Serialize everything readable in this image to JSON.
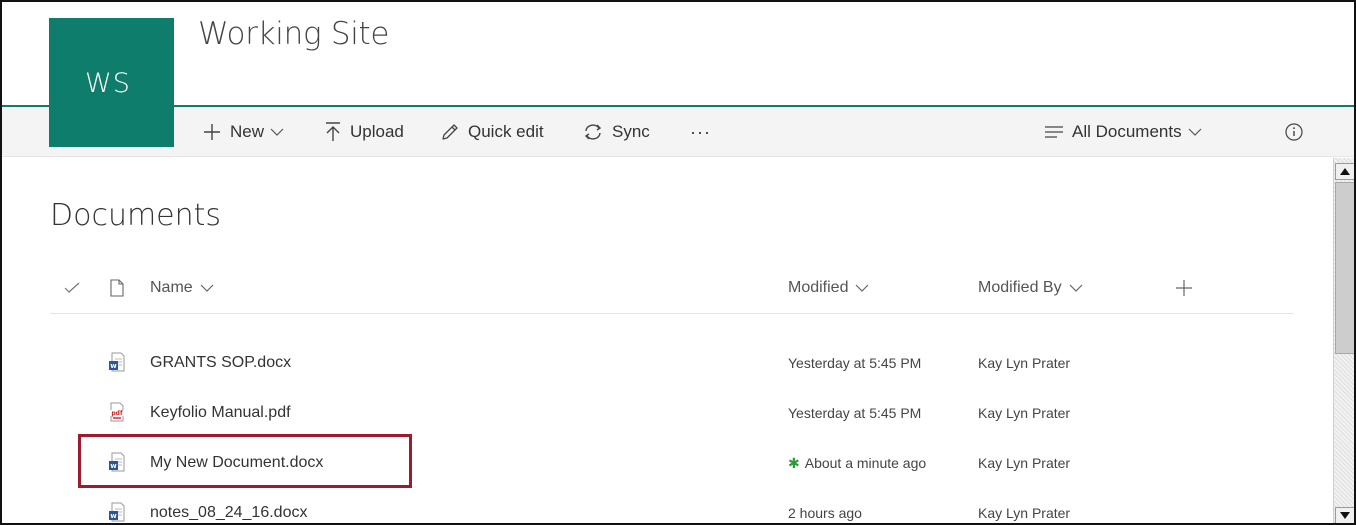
{
  "site": {
    "logo_text": "WS",
    "title": "Working Site",
    "brand_color": "#0f7d6b"
  },
  "command_bar": {
    "new_label": "New",
    "upload_label": "Upload",
    "quick_edit_label": "Quick edit",
    "sync_label": "Sync",
    "more_label": "···",
    "view_label": "All Documents"
  },
  "library": {
    "title": "Documents",
    "columns": {
      "name": "Name",
      "modified": "Modified",
      "modified_by": "Modified By"
    },
    "files": [
      {
        "name": "GRANTS SOP.docx",
        "type": "word",
        "modified": "Yesterday at 5:45 PM",
        "modified_by": "Kay Lyn Prater",
        "is_new": false
      },
      {
        "name": "Keyfolio Manual.pdf",
        "type": "pdf",
        "modified": "Yesterday at 5:45 PM",
        "modified_by": "Kay Lyn Prater",
        "is_new": false
      },
      {
        "name": "My New Document.docx",
        "type": "word",
        "modified": "About a minute ago",
        "modified_by": "Kay Lyn Prater",
        "is_new": true
      },
      {
        "name": "notes_08_24_16.docx",
        "type": "word",
        "modified": "2 hours ago",
        "modified_by": "Kay Lyn Prater",
        "is_new": false
      }
    ],
    "new_marker": "✱"
  },
  "colors": {
    "accent": "#0f7d6b",
    "highlight_box": "#9e1b2e",
    "new_star": "#2b9b3a"
  }
}
